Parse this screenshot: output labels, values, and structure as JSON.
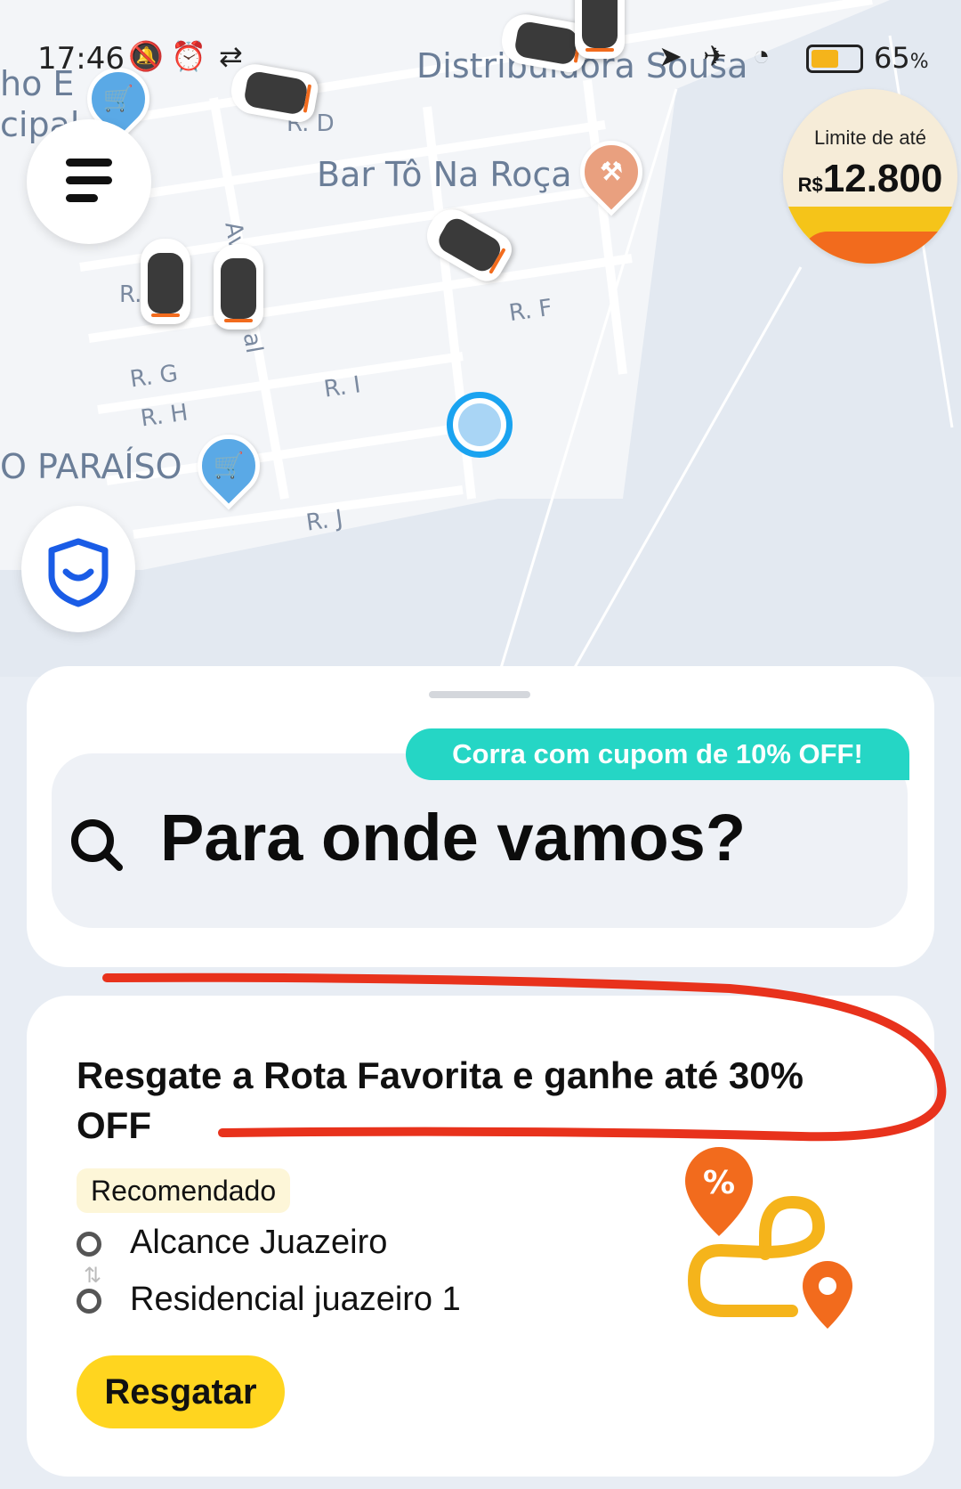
{
  "status_bar": {
    "time": "17:46",
    "battery_percent": "65",
    "battery_pct_sign": "%",
    "battery_level": 0.65
  },
  "map": {
    "poi": {
      "distribuidora": "Distribuidora Sousa",
      "bar": "Bar Tô Na Roça",
      "paraiso": "O PARAÍSO",
      "left_top_1": "ho E",
      "left_top_2": "cipal"
    },
    "streets": {
      "rd": "R. D",
      "rf": "R. F",
      "rg": "R. G",
      "rh": "R. H",
      "ri": "R. I",
      "rj": "R. J",
      "r": "R.",
      "av": "Av",
      "al": "al"
    }
  },
  "limit_badge": {
    "line1": "Limite de até",
    "currency": "R$",
    "amount": "12.800"
  },
  "search": {
    "coupon": "Corra com cupom de 10% OFF!",
    "placeholder": "Para onde vamos?"
  },
  "promo": {
    "title": "Resgate a Rota Favorita e ganhe até 30% OFF",
    "tag": "Recomendado",
    "origin": "Alcance Juazeiro",
    "destination": "Residencial juazeiro 1",
    "button": "Resgatar"
  },
  "colors": {
    "accent_yellow": "#ffd51f",
    "coupon_teal": "#25d6c5",
    "orange": "#f26b1d",
    "location_blue": "#1aa3f0",
    "annotation_red": "#e8321c"
  }
}
